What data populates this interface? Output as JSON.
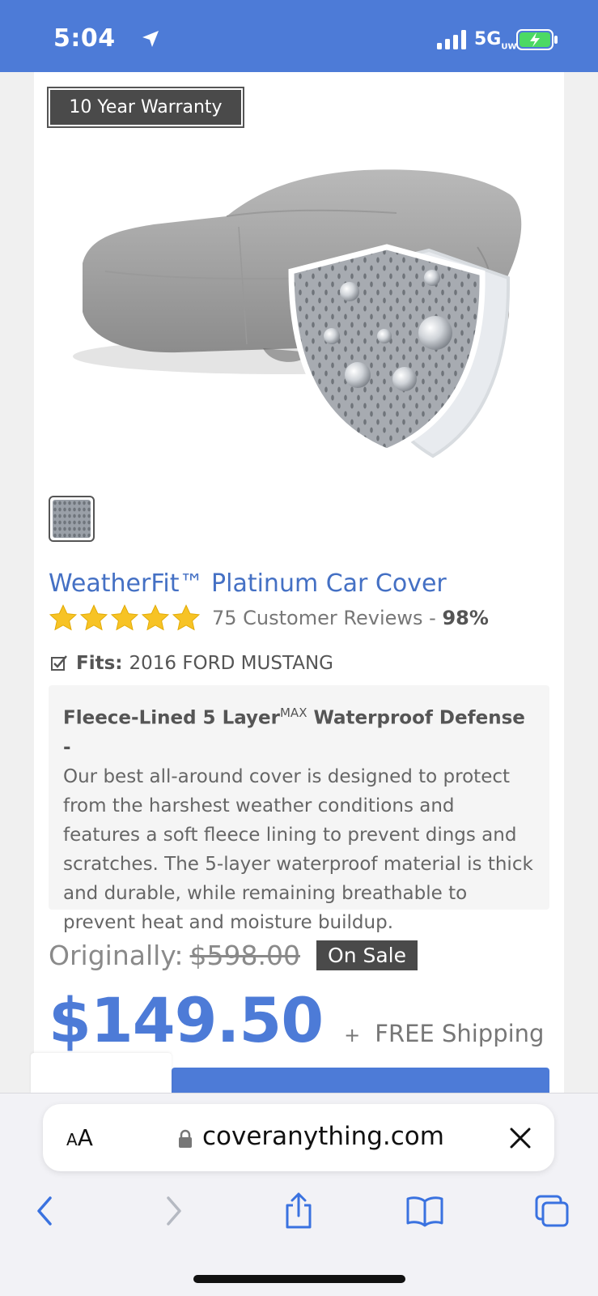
{
  "status_bar": {
    "time": "5:04",
    "network": "5G",
    "network_sub": "UW",
    "accent_color": "#4d7bd7",
    "icons": [
      "location-arrow-icon",
      "signal-bars-icon",
      "battery-charging-icon"
    ]
  },
  "product": {
    "warranty_badge": "10 Year Warranty",
    "title": "WeatherFit™ Platinum Car Cover",
    "rating_stars": 5,
    "reviews_text": "75 Customer Reviews - ",
    "rating_percent": "98%",
    "fits_label": "Fits:",
    "fits_value": "2016 FORD MUSTANG",
    "description_head": "Fleece-Lined 5 Layer",
    "description_head_sup": "MAX",
    "description_head_tail": " Waterproof Defense -",
    "description_body": "Our best all-around cover is designed to protect from the harshest weather conditions and features a soft fleece lining to prevent dings and scratches. The 5-layer waterproof material is thick and durable, while remaining breathable to prevent heat and moisture buildup.",
    "original_label": "Originally:",
    "original_price": "$598.00",
    "sale_badge": "On Sale",
    "price": "$149.50",
    "plus": "+",
    "shipping": "FREE Shipping"
  },
  "browser": {
    "text_size_label": "A",
    "text_size_label_large": "A",
    "url": "coveranything.com"
  }
}
